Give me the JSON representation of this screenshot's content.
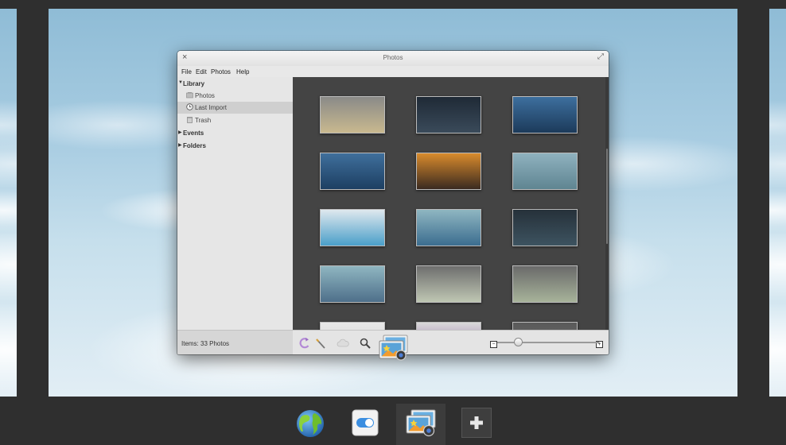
{
  "window": {
    "title": "Photos"
  },
  "menu": [
    "File",
    "Edit",
    "Photos",
    "Help"
  ],
  "sidebar": {
    "library": "Library",
    "photos": "Photos",
    "last_import": "Last Import",
    "trash": "Trash",
    "events": "Events",
    "folders": "Folders"
  },
  "status": {
    "items_text": "Items:  33 Photos"
  },
  "zoom": {
    "level": 0.2
  },
  "thumbnails": [
    {
      "name": "lighthouse-photo",
      "colors": [
        "#8a8a88",
        "#c9b98f"
      ]
    },
    {
      "name": "dark-desktop-icons-screenshot",
      "colors": [
        "#1f2a36",
        "#3a4a5a"
      ]
    },
    {
      "name": "island-desktop-menu-screenshot",
      "colors": [
        "#3d6f9e",
        "#1c3a5a"
      ]
    },
    {
      "name": "island-desktop-screenshot",
      "colors": [
        "#3f6f9c",
        "#1d3f62"
      ]
    },
    {
      "name": "sailboat-sunset-wallpaper",
      "colors": [
        "#d98b2c",
        "#3a2a20"
      ]
    },
    {
      "name": "bamboo-desktop-screenshot",
      "colors": [
        "#8fb2bf",
        "#5f8591"
      ]
    },
    {
      "name": "file-manager-screenshot",
      "colors": [
        "#dfe8ee",
        "#4a9fc9"
      ]
    },
    {
      "name": "bamboo-desktop-windows-screenshot",
      "colors": [
        "#8fb6c1",
        "#3b6d8f"
      ]
    },
    {
      "name": "app-grid-dark-screenshot",
      "colors": [
        "#26313a",
        "#3d5360"
      ]
    },
    {
      "name": "desktop-dialog-screenshot",
      "colors": [
        "#8fb6c1",
        "#4e6f8a"
      ]
    },
    {
      "name": "multitasking-view-screenshot",
      "colors": [
        "#6e6e6e",
        "#bfc7b3"
      ]
    },
    {
      "name": "workspace-overview-screenshot",
      "colors": [
        "#6a6a6a",
        "#a7b39a"
      ]
    },
    {
      "name": "partial-light-screenshot",
      "colors": [
        "#e8e8e8",
        "#cfcfcf"
      ]
    },
    {
      "name": "partial-colorful-screenshot",
      "colors": [
        "#d9d9d9",
        "#8c5aa5"
      ]
    },
    {
      "name": "partial-dark-screenshot",
      "colors": [
        "#5a5a5a",
        "#6d6d6d"
      ]
    }
  ],
  "dock": [
    "browser-app-icon",
    "settings-app-icon",
    "photos-app-icon",
    "add-app-icon"
  ]
}
